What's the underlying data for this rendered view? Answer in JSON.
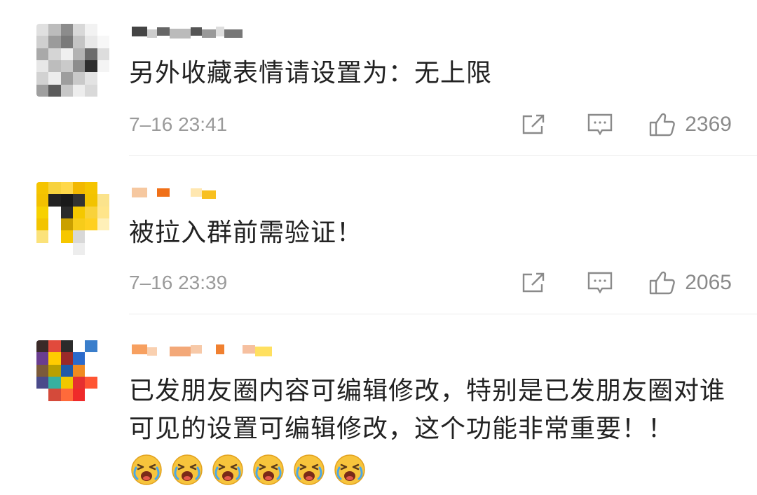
{
  "comments": [
    {
      "text": "另外收藏表情请设置为：无上限",
      "time": "7–16 23:41",
      "likes": "2369",
      "avatar_colors": [
        "#e0e0e0",
        "#bcbcbc",
        "#8c8c8c",
        "#d8d8d8",
        "#f2f2f2",
        "#ffffff",
        "#cfcfcf",
        "#9b9b9b",
        "#7a7a7a",
        "#c4c4c4",
        "#e8e8e8",
        "#f7f7f7",
        "#a9a9a9",
        "#d5d5d5",
        "#f0f0f0",
        "#b3b3b3",
        "#6b6b6b",
        "#dddddd",
        "#e7e7e7",
        "#bdbdbd",
        "#cacaca",
        "#8d8d8d",
        "#2e2e2e",
        "#f4f4f4",
        "#d2d2d2",
        "#ededed",
        "#9e9e9e",
        "#c9c9c9",
        "#e3e3e3",
        "#ffffff",
        "#9f9f9f",
        "#5b5b5b",
        "#c7c7c7",
        "#ededed",
        "#d9d9d9",
        "#ffffff"
      ],
      "name_colors": [
        "#444444",
        "#cccccc",
        "#666666",
        "#bbbbbb",
        "#555555",
        "#999999",
        "#dddddd",
        "#777777"
      ]
    },
    {
      "text": "被拉入群前需验证！",
      "time": "7–16 23:39",
      "likes": "2065",
      "avatar_colors": [
        "#f5c400",
        "#f7d23e",
        "#ffd84a",
        "#f2b800",
        "#f5c400",
        "#ffffff",
        "#f3c100",
        "#222222",
        "#1a1a1a",
        "#333333",
        "#f2c300",
        "#fbe38c",
        "#f7d100",
        "#ffffff",
        "#2b2b2b",
        "#f5c800",
        "#f9d23a",
        "#ffe58a",
        "#f3c400",
        "#ffffff",
        "#caa000",
        "#f7cc1a",
        "#ffd020",
        "#fff0b8",
        "#fbe27a",
        "#ffffff",
        "#f6c700",
        "#d8d8d8",
        "#ffffff",
        "#ffffff",
        "#ffffff",
        "#ffffff",
        "#ffffff",
        "#ededed",
        "#ffffff",
        "#ffffff"
      ],
      "name_colors": [
        "#f6c8a0",
        "#ffffff",
        "#f07018",
        "#ffffff",
        "#ffe7b0",
        "#f8c020"
      ]
    },
    {
      "text": "已发朋友圈内容可编辑修改，特别是已发朋友圈对谁可见的设置可编辑修改，这个功能非常重要！！",
      "emoji_count": "6",
      "avatar_colors": [
        "#3a2a28",
        "#e14a3c",
        "#2b2b2b",
        "#ffffff",
        "#3a7ecb",
        "#ffffff",
        "#6a3d8f",
        "#ffcc00",
        "#9a2a2a",
        "#2a6acb",
        "#ffffff",
        "#ffffff",
        "#7b5a3a",
        "#b8a000",
        "#1f5aa8",
        "#f08a20",
        "#ffffff",
        "#ffffff",
        "#4a4a8a",
        "#36b0a0",
        "#f0c800",
        "#e63030",
        "#ff5533",
        "#ffffff",
        "#ffffff",
        "#d44a3a",
        "#ff6a3a",
        "#ef2a2a",
        "#ffffff",
        "#ffffff",
        "#ffffff",
        "#ffffff",
        "#ffffff",
        "#ffffff",
        "#ffffff",
        "#ffffff"
      ],
      "name_colors": [
        "#f7a060",
        "#f9d0b0",
        "#ffffff",
        "#f3a878",
        "#f7c9a8",
        "#ffffff",
        "#f08030",
        "#ffffff",
        "#f6c0a0",
        "#ffe060"
      ]
    }
  ],
  "icons": {
    "share": "share-icon",
    "reply": "reply-icon",
    "like": "like-icon"
  },
  "colors": {
    "text": "#222222",
    "meta": "#9a9a9a",
    "divider": "#ececec"
  }
}
